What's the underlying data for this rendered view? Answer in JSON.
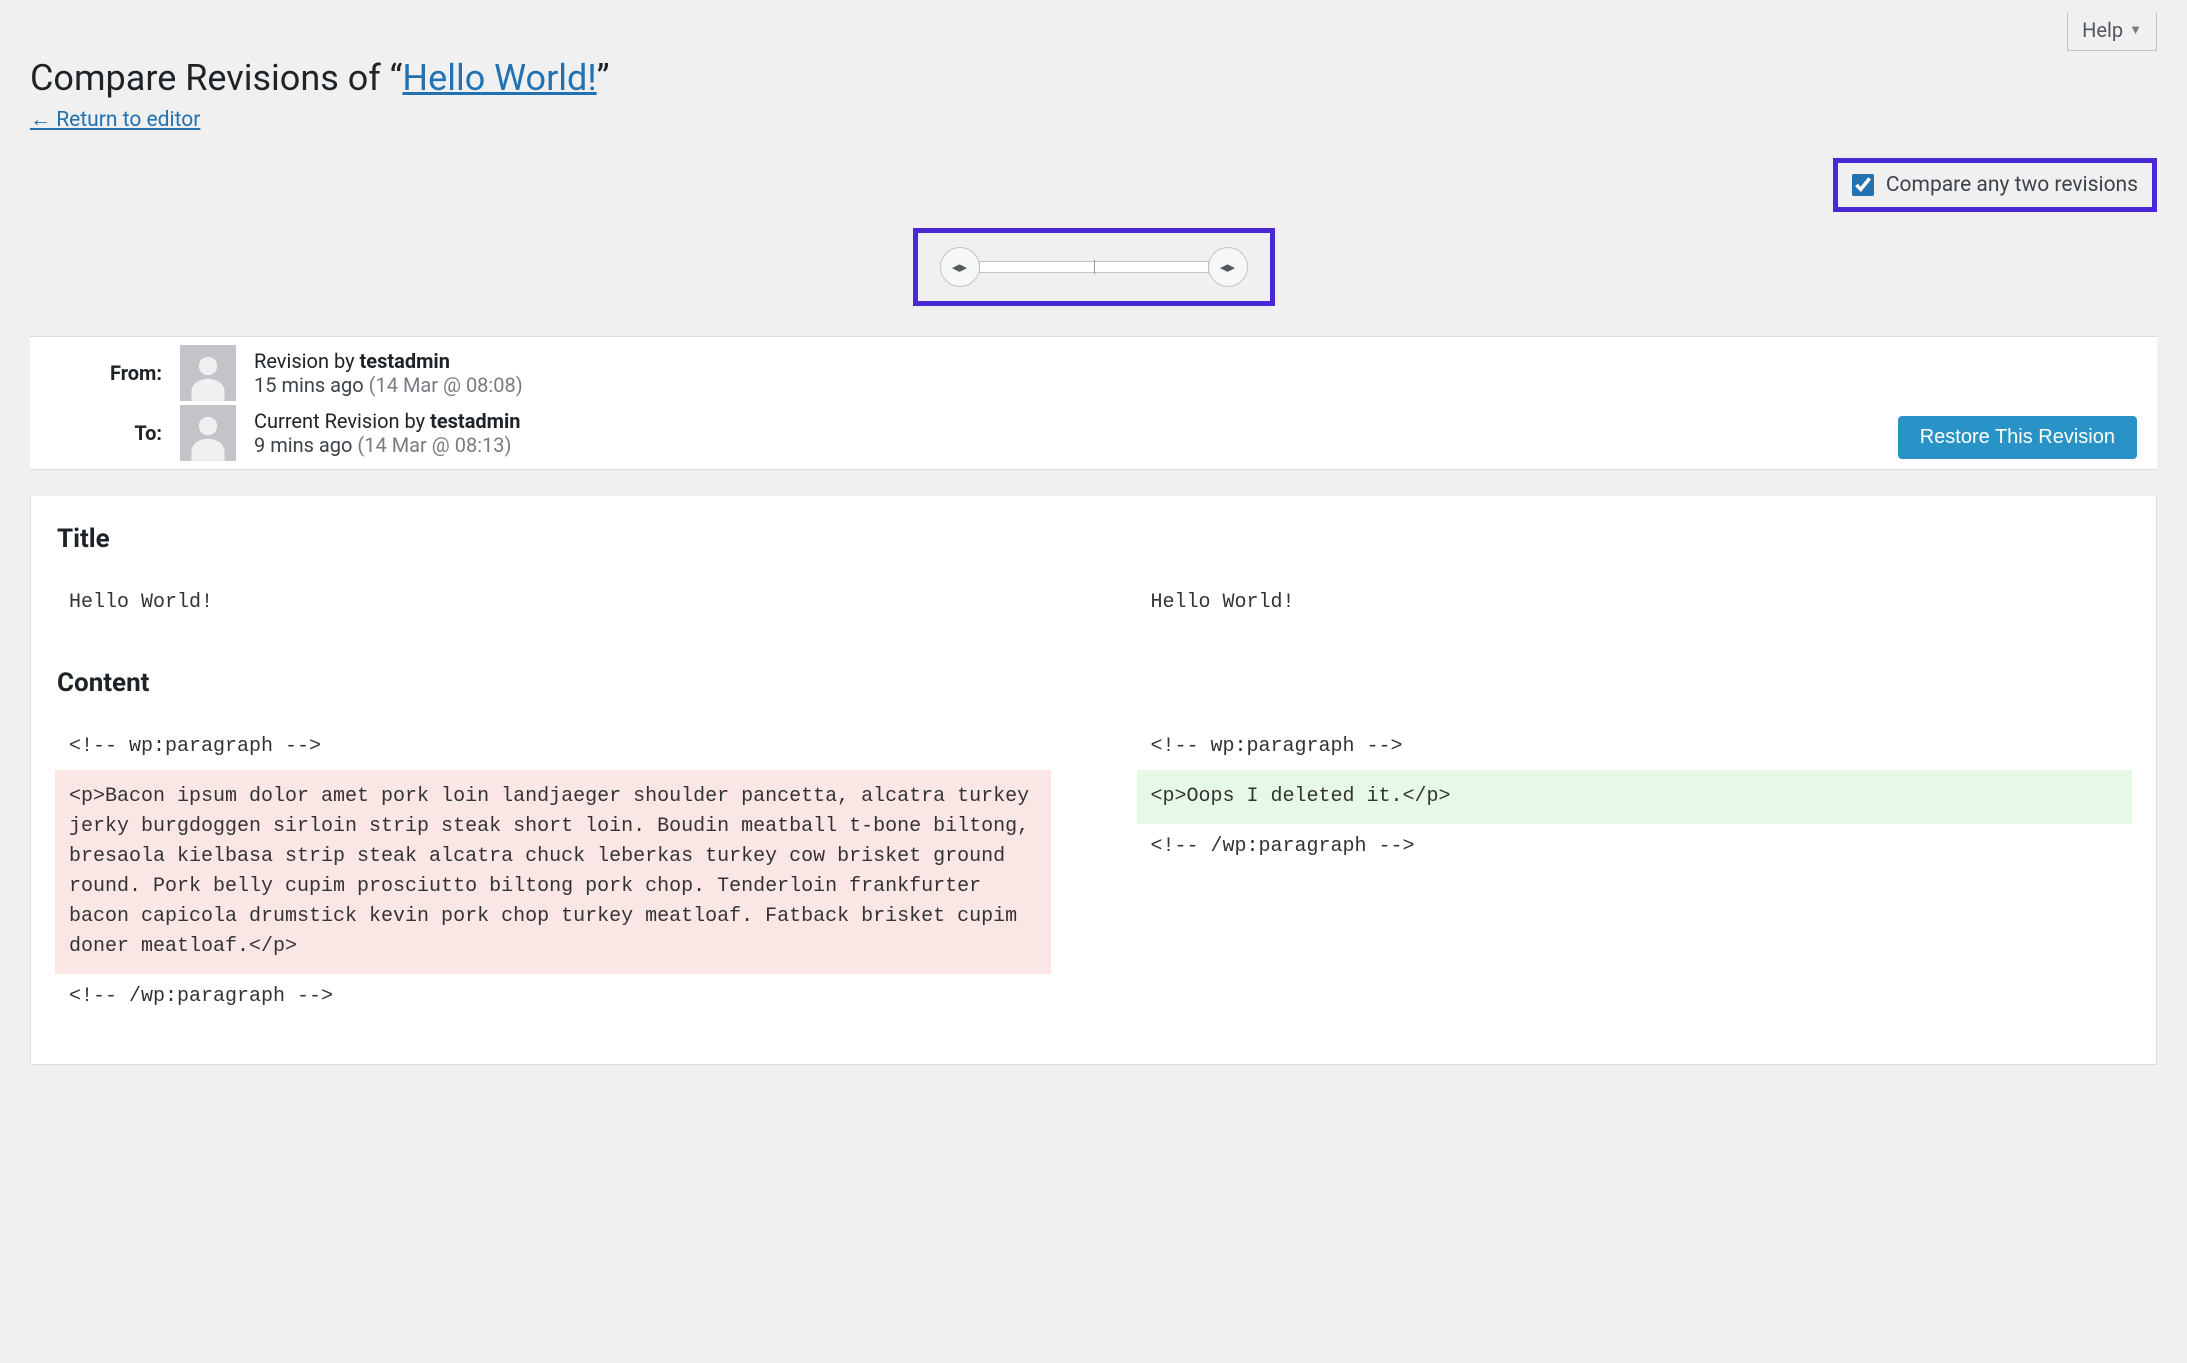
{
  "help": {
    "label": "Help"
  },
  "title": {
    "prefix": "Compare Revisions of “",
    "link_text": "Hello World!",
    "suffix": "”"
  },
  "return_link": "← Return to editor",
  "compare_toggle": {
    "label": "Compare any two revisions",
    "checked": true
  },
  "meta": {
    "from": {
      "label": "From:",
      "line1_prefix": "Revision by ",
      "author": "testadmin",
      "age": "15 mins ago",
      "timestamp": "(14 Mar @ 08:08)"
    },
    "to": {
      "label": "To:",
      "line1_prefix": "Current Revision by ",
      "author": "testadmin",
      "age": "9 mins ago",
      "timestamp": "(14 Mar @ 08:13)"
    },
    "restore_label": "Restore This Revision"
  },
  "diff": {
    "title_heading": "Title",
    "content_heading": "Content",
    "title_left": "Hello World!",
    "title_right": "Hello World!",
    "open_left": "<!-- wp:paragraph -->",
    "open_right": "<!-- wp:paragraph -->",
    "body_left": "<p>Bacon ipsum dolor amet pork loin landjaeger shoulder pancetta, alcatra turkey jerky burgdoggen sirloin strip steak short loin. Boudin meatball t-bone biltong, bresaola kielbasa strip steak alcatra chuck leberkas turkey cow brisket ground round. Pork belly cupim prosciutto biltong pork chop. Tenderloin frankfurter bacon capicola drumstick kevin pork chop turkey meatloaf. Fatback brisket cupim doner meatloaf.</p>",
    "body_right": "<p>Oops I deleted it.</p>",
    "close_left": "<!-- /wp:paragraph -->",
    "close_right": "<!-- /wp:paragraph -->"
  }
}
